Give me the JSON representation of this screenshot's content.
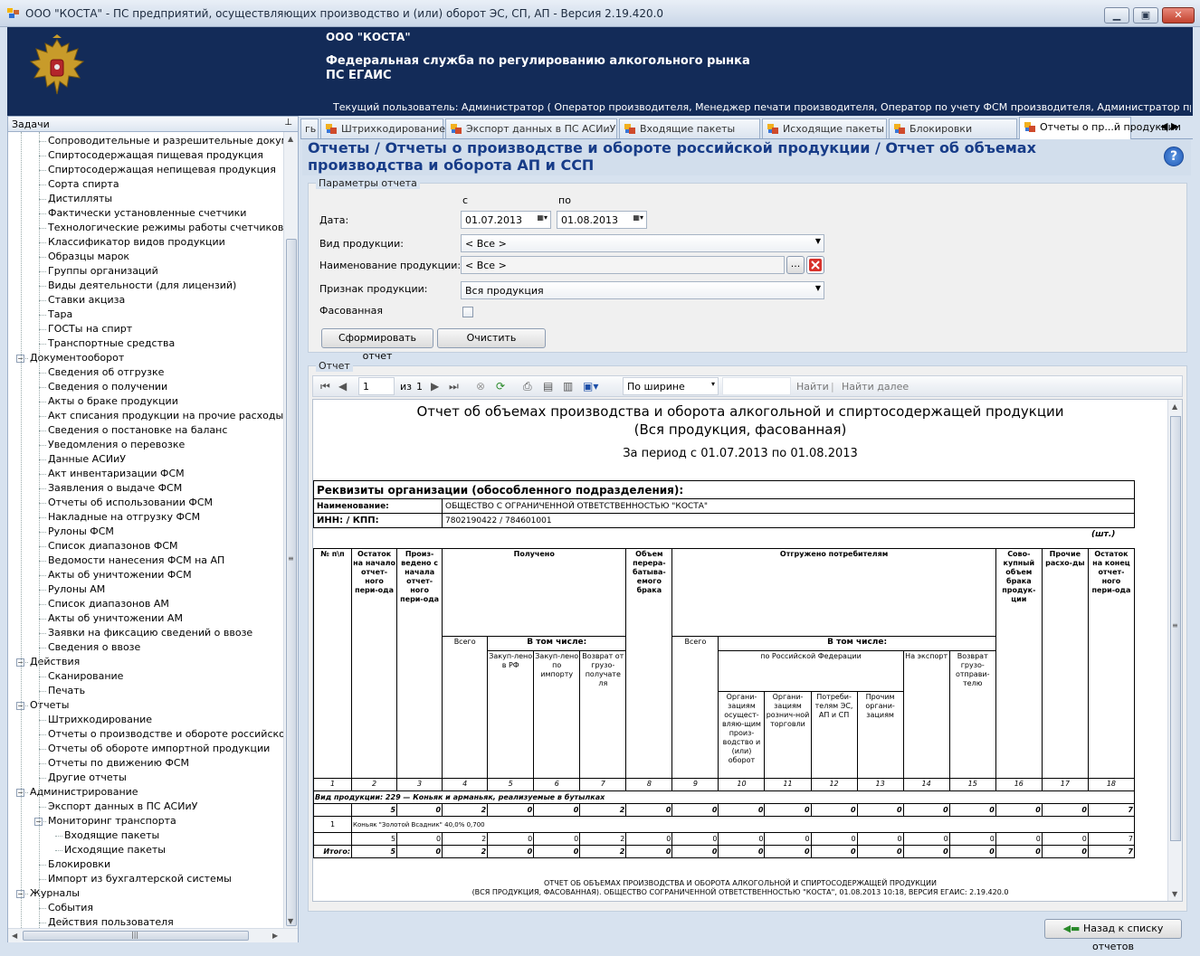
{
  "window": {
    "title": "ООО \"КОСТА\" - ПС предприятий, осуществляющих производство и (или) оборот ЭС, СП, АП - Версия 2.19.420.0",
    "minimize": "▁",
    "maximize": "▣",
    "close": "✕"
  },
  "header": {
    "org": "ООО \"КОСТА\"",
    "federal": "Федеральная служба по регулированию алкогольного рынка",
    "ps": "ПС ЕГАИС",
    "user": "Текущий пользователь: Администратор ( Оператор производителя, Менеджер печати производителя, Оператор по учету ФСМ производителя, Администратор производителя, Операт..."
  },
  "tasks": {
    "title": "Задачи",
    "pin": "⊥",
    "items": [
      {
        "label": "Сопроводительные и разрешительные документы",
        "level": 2
      },
      {
        "label": "Спиртосодержащая пищевая продукция",
        "level": 2
      },
      {
        "label": "Спиртосодержащая непищевая продукция",
        "level": 2
      },
      {
        "label": "Сорта спирта",
        "level": 2
      },
      {
        "label": "Дистилляты",
        "level": 2
      },
      {
        "label": "Фактически установленные счетчики",
        "level": 2
      },
      {
        "label": "Технологические режимы работы счетчиков",
        "level": 2
      },
      {
        "label": "Классификатор видов продукции",
        "level": 2
      },
      {
        "label": "Образцы марок",
        "level": 2
      },
      {
        "label": "Группы организаций",
        "level": 2
      },
      {
        "label": "Виды деятельности (для лицензий)",
        "level": 2
      },
      {
        "label": "Ставки акциза",
        "level": 2
      },
      {
        "label": "Тара",
        "level": 2
      },
      {
        "label": "ГОСТы на спирт",
        "level": 2
      },
      {
        "label": "Транспортные средства",
        "level": 2
      },
      {
        "label": "Документооборот",
        "level": 1,
        "box": "−"
      },
      {
        "label": "Сведения об отгрузке",
        "level": 2
      },
      {
        "label": "Сведения о получении",
        "level": 2
      },
      {
        "label": "Акты о браке продукции",
        "level": 2
      },
      {
        "label": "Акт списания продукции на прочие расходы",
        "level": 2
      },
      {
        "label": "Сведения о постановке на баланс",
        "level": 2
      },
      {
        "label": "Уведомления о перевозке",
        "level": 2
      },
      {
        "label": "Данные АСИиУ",
        "level": 2
      },
      {
        "label": "Акт инвентаризации ФСМ",
        "level": 2
      },
      {
        "label": "Заявления о выдаче ФСМ",
        "level": 2
      },
      {
        "label": "Отчеты об использовании ФСМ",
        "level": 2
      },
      {
        "label": "Накладные на отгрузку ФСМ",
        "level": 2
      },
      {
        "label": "Рулоны ФСМ",
        "level": 2
      },
      {
        "label": "Список диапазонов ФСМ",
        "level": 2
      },
      {
        "label": "Ведомости нанесения ФСМ на АП",
        "level": 2
      },
      {
        "label": "Акты об уничтожении ФСМ",
        "level": 2
      },
      {
        "label": "Рулоны АМ",
        "level": 2
      },
      {
        "label": "Список диапазонов АМ",
        "level": 2
      },
      {
        "label": "Акты об уничтожении АМ",
        "level": 2
      },
      {
        "label": "Заявки на фиксацию сведений о ввозе",
        "level": 2
      },
      {
        "label": "Сведения о ввозе",
        "level": 2
      },
      {
        "label": "Действия",
        "level": 1,
        "box": "−"
      },
      {
        "label": "Сканирование",
        "level": 2
      },
      {
        "label": "Печать",
        "level": 2
      },
      {
        "label": "Отчеты",
        "level": 1,
        "box": "−"
      },
      {
        "label": "Штрихкодирование",
        "level": 2
      },
      {
        "label": "Отчеты о производстве и обороте российской про,",
        "level": 2
      },
      {
        "label": "Отчеты об обороте импортной продукции",
        "level": 2
      },
      {
        "label": "Отчеты по движению ФСМ",
        "level": 2
      },
      {
        "label": "Другие отчеты",
        "level": 2
      },
      {
        "label": "Администрирование",
        "level": 1,
        "box": "−"
      },
      {
        "label": "Экспорт данных в ПС АСИиУ",
        "level": 2
      },
      {
        "label": "Мониторинг транспорта",
        "level": 2,
        "box": "−"
      },
      {
        "label": "Входящие пакеты",
        "level": 3
      },
      {
        "label": "Исходящие пакеты",
        "level": 3
      },
      {
        "label": "Блокировки",
        "level": 2
      },
      {
        "label": "Импорт из бухгалтерской системы",
        "level": 2
      },
      {
        "label": "Журналы",
        "level": 1,
        "box": "−"
      },
      {
        "label": "События",
        "level": 2
      },
      {
        "label": "Действия пользователя",
        "level": 2
      }
    ]
  },
  "tabs": [
    {
      "label": "гь",
      "icon": false
    },
    {
      "label": "Штрихкодирование",
      "icon": true
    },
    {
      "label": "Экспорт данных в ПС АСИиУ",
      "icon": true
    },
    {
      "label": "Входящие пакеты",
      "icon": true
    },
    {
      "label": "Исходящие пакеты",
      "icon": true
    },
    {
      "label": "Блокировки",
      "icon": true
    },
    {
      "label": "Отчеты о пр...й продукции",
      "icon": true,
      "active": true
    }
  ],
  "tab_arrows": "◀ ▶",
  "page_title": "Отчеты / Отчеты о производстве и обороте российской продукции / Отчет об объемах производства и оборота АП и ССП",
  "help": "?",
  "params": {
    "caption": "Параметры отчета",
    "from_label": "с",
    "to_label": "по",
    "date_label": "Дата:",
    "date_from": "01.07.2013",
    "date_to": "01.08.2013",
    "product_type_label": "Вид продукции:",
    "product_type": "< Все >",
    "product_name_label": "Наименование продукции:",
    "product_name": "< Все >",
    "browse": "...",
    "product_sign_label": "Признак продукции:",
    "product_sign": "Вся продукция",
    "packaged_label": "Фасованная",
    "packaged": false,
    "generate_button": "Сформировать отчет",
    "clear_button": "Очистить"
  },
  "report": {
    "caption": "Отчет",
    "toolbar": {
      "page": "1",
      "of": "из",
      "total": "1",
      "zoom": "По ширине",
      "find": "Найти",
      "separator": "|",
      "find_next": "Найти далее"
    },
    "title1": "Отчет об объемах производства и оборота алкогольной и спиртосодержащей продукции",
    "title2": "(Вся продукция, фасованная)",
    "period": "За период с 01.07.2013 по 01.08.2013",
    "requisites": {
      "header": "Реквизиты организации (обособленного подразделения):",
      "name_label": "Наименование:",
      "name": "ОБЩЕСТВО С ОГРАНИЧЕННОЙ ОТВЕТСТВЕННОСТЬЮ \"КОСТА\"",
      "inn_label": "ИНН: / КПП:",
      "inn": "7802190422 / 784601001"
    },
    "units": "(шт.)",
    "cols": {
      "num": "№ п\\п",
      "rest_start": "Остаток на начало отчет-ного пери-ода",
      "produced": "Произ-ведено с начала отчет-ного пери-ода",
      "received": "Получено",
      "rework": "Объем перера-батыва-емого брака",
      "shipped": "Отгружено потребителям",
      "defect": "Сово-купный объем брака продук-ции",
      "other": "Прочие расхо-ды",
      "rest_end": "Остаток на конец отчет-ного пери-ода",
      "total": "Всего",
      "incl": "В том числе:",
      "buy_rf": "Закуп-лено в РФ",
      "buy_imp": "Закуп-лено по импорту",
      "ret_buyer": "Возврат от грузо-получате ля",
      "total2": "Всего",
      "incl2": "В том числе:",
      "rf": "по Российской Федерации",
      "export": "На экспорт",
      "ret_sender": "Возврат грузо-отправи-телю",
      "org_prod": "Органи-зациям осущест-вляю-щим произ-водство и (или) оборот",
      "retail": "Органи-зациям рознич-ной торговли",
      "consumers": "Потреби-телям ЭС, АП и СП",
      "others": "Прочим органи-зациям"
    },
    "colnums": [
      "1",
      "2",
      "3",
      "4",
      "5",
      "6",
      "7",
      "8",
      "9",
      "10",
      "11",
      "12",
      "13",
      "14",
      "15",
      "16",
      "17",
      "18"
    ],
    "group_label": "Вид продукции: 229 — Коньяк и арманьяк, реализуемые в бутылках",
    "group_row": [
      "5",
      "0",
      "2",
      "0",
      "0",
      "2",
      "0",
      "0",
      "0",
      "0",
      "0",
      "0",
      "0",
      "0",
      "0",
      "0",
      "7"
    ],
    "item_num": "1",
    "item_name": "Коньяк \"Золотой Всадник\" 40,0% 0,700",
    "item_row": [
      "5",
      "0",
      "2",
      "0",
      "0",
      "2",
      "0",
      "0",
      "0",
      "0",
      "0",
      "0",
      "0",
      "0",
      "0",
      "0",
      "7"
    ],
    "total_label": "Итого:",
    "total_row": [
      "5",
      "0",
      "2",
      "0",
      "0",
      "2",
      "0",
      "0",
      "0",
      "0",
      "0",
      "0",
      "0",
      "0",
      "0",
      "0",
      "7"
    ],
    "footer1": "ОТЧЕТ ОБ ОБЪЕМАХ ПРОИЗВОДСТВА И ОБОРОТА АЛКОГОЛЬНОЙ И СПИРТОСОДЕРЖАЩЕЙ ПРОДУКЦИИ",
    "footer2": "(ВСЯ ПРОДУКЦИЯ, ФАСОВАННАЯ). ОБЩЕСТВО СОГРАНИЧЕННОЙ ОТВЕТСТВЕННОСТЬЮ \"КОСТА\", 01.08.2013 10:18, ВЕРСИЯ ЕГАИС: 2.19.420.0"
  },
  "back_button": "Назад к списку отчетов"
}
